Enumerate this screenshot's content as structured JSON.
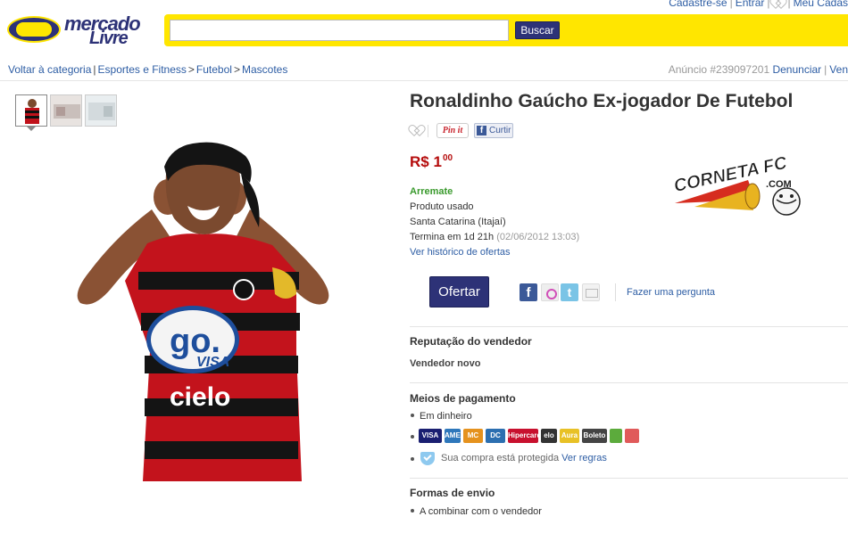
{
  "header": {
    "logo_line1": "mercado",
    "logo_line2": "Livre",
    "search_value": "",
    "search_button": "Buscar",
    "top_links": [
      "Cadastre-se",
      "Entrar",
      "Meu Cadas"
    ]
  },
  "breadcrumb": {
    "back": "Voltar à categoria",
    "path": [
      "Esportes e Fitness",
      "Futebol",
      "Mascotes"
    ]
  },
  "listing": {
    "anuncio_label": "Anúncio #239097201",
    "denunciar": "Denunciar",
    "vender": "Ven"
  },
  "product": {
    "title": "Ronaldinho Gaúcho Ex-jogador De Futebol",
    "pinit": "Pin it",
    "curtir": "Curtir",
    "currency": "R$",
    "price_int": "1",
    "price_cents": "00",
    "buy_type": "Arremate",
    "condition": "Produto usado",
    "location": "Santa Catarina (Itajaí)",
    "ends_label": "Termina em 1d 21h",
    "ends_date": "(02/06/2012 13:03)",
    "history_link": "Ver histórico de ofertas",
    "ofertar_button": "Ofertar",
    "ask_link": "Fazer uma pergunta",
    "jersey_text": "go.",
    "jersey_subtext": "VISA",
    "jersey_sponsor": "cielo"
  },
  "seller": {
    "reputation_title": "Reputação do vendedor",
    "reputation_value": "Vendedor novo"
  },
  "payment": {
    "title": "Meios de pagamento",
    "cash": "Em dinheiro",
    "icons": [
      {
        "name": "visa-icon",
        "label": "VISA",
        "color": "#1a1f71"
      },
      {
        "name": "amex-icon",
        "label": "AMEX",
        "color": "#2e77bb"
      },
      {
        "name": "mastercard-icon",
        "label": "MC",
        "color": "#e5921e"
      },
      {
        "name": "diners-icon",
        "label": "DC",
        "color": "#2c6fb0"
      },
      {
        "name": "hipercard-icon",
        "label": "Hipercard",
        "color": "#c8102e"
      },
      {
        "name": "elo-icon",
        "label": "elo",
        "color": "#333333"
      },
      {
        "name": "aura-icon",
        "label": "Aura",
        "color": "#e8c126"
      },
      {
        "name": "boleto-icon",
        "label": "Boleto",
        "color": "#444444"
      },
      {
        "name": "bradesco-icon",
        "label": "",
        "color": "#5cab3c"
      },
      {
        "name": "bank-icon",
        "label": "",
        "color": "#e05a5a"
      }
    ],
    "protect_text": "Sua compra está protegida",
    "protect_link": "Ver regras"
  },
  "shipping": {
    "title": "Formas de envio",
    "value": "A combinar com o vendedor"
  },
  "watermark": {
    "line1": "CORNETA FC",
    "line2": ".COM"
  }
}
